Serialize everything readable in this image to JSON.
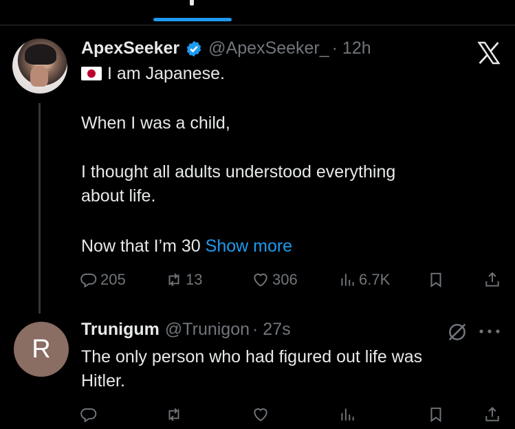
{
  "tweet1": {
    "author_name": "ApexSeeker",
    "handle": "@ApexSeeker_",
    "time": "· 12h",
    "line1": "I am Japanese.",
    "line2": "When I was a child,",
    "line3": "I thought all adults understood everything",
    "line4": "about life.",
    "line5": "Now that I’m 30",
    "show_more": "Show more",
    "actions": {
      "replies": "205",
      "reposts": "13",
      "likes": "306",
      "views": "6.7K"
    }
  },
  "tweet2": {
    "avatar_letter": "R",
    "author_name": "Trunigum",
    "handle": "@Trunigon",
    "time": "· 27s",
    "line1": "The only person who had figured out life was",
    "line2": "Hitler."
  },
  "icons": {
    "verified": "verified-badge-icon",
    "flag": "japan-flag-icon",
    "brand": "x-logo-icon"
  },
  "colors": {
    "background": "#000000",
    "text": "#e7e9ea",
    "muted": "#71767b",
    "accent": "#1d9bf0"
  }
}
